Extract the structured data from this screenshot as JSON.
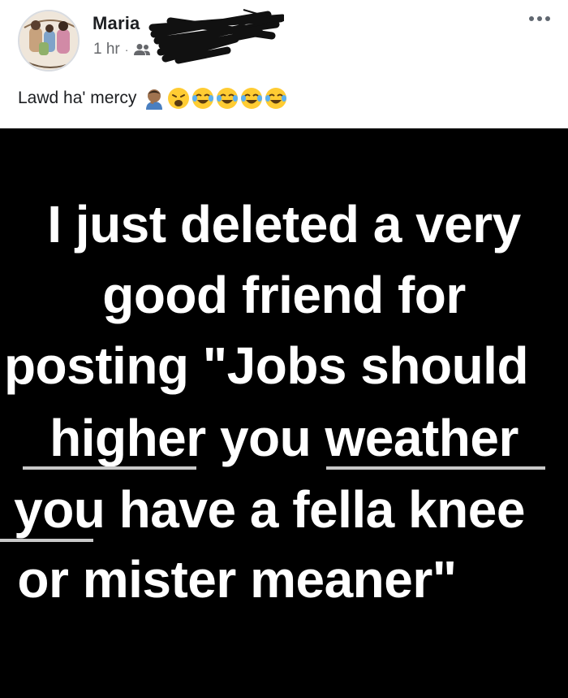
{
  "post": {
    "author_name": "Maria",
    "timestamp": "1 hr",
    "separator": "·",
    "audience_icon": "friends-icon",
    "more_icon": "more-options-icon",
    "caption": "Lawd ha' mercy",
    "emojis": [
      "man-facepalming-emoji",
      "weary-face-emoji",
      "face-with-tears-of-joy-emoji",
      "face-with-tears-of-joy-emoji",
      "face-with-tears-of-joy-emoji",
      "face-with-tears-of-joy-emoji"
    ]
  },
  "meme": {
    "lines": [
      "I just deleted a very",
      "good friend for",
      "posting \"Jobs should",
      "higher you weather",
      "you have a fella knee",
      "or mister meaner\""
    ],
    "underlined_words": [
      "higher",
      "weather",
      "you"
    ]
  },
  "colors": {
    "image_background": "#000000",
    "meme_text": "#ffffff",
    "name_text": "#1c1e21",
    "meta_text": "#65676b"
  }
}
